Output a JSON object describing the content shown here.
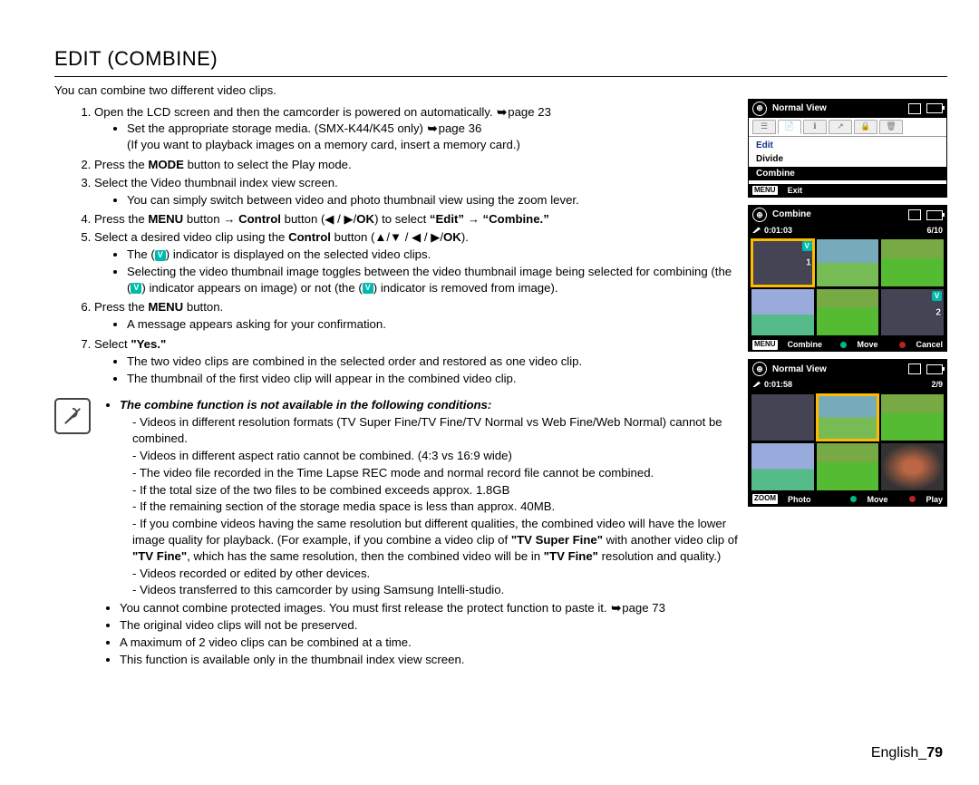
{
  "title": "EDIT (COMBINE)",
  "intro": "You can combine two different video clips.",
  "steps": {
    "s1": "Open the LCD screen and then the camcorder is powered on automatically.",
    "s1_page": "page 23",
    "s1_b1a": "Set the appropriate storage media. (SMX-K44/K45 only)",
    "s1_b1a_page": "page 36",
    "s1_b1b": "(If you want to playback images on a memory card, insert a memory card.)",
    "s2a": "Press the ",
    "s2_mode": "MODE",
    "s2b": " button to select the Play mode.",
    "s3": "Select the Video thumbnail index view screen.",
    "s3_b1": "You can simply switch between video and photo thumbnail view using the zoom lever.",
    "s4a": "Press the ",
    "s4_menu": "MENU",
    "s4b": " button → ",
    "s4_control": "Control",
    "s4c": " button (◀ / ▶/",
    "s4_ok": "OK",
    "s4d": ") to select ",
    "s4_edit": "“Edit”",
    "s4_arrow": " → ",
    "s4_combine": "“Combine.”",
    "s5a": "Select a desired video clip using the ",
    "s5_control": "Control",
    "s5b": " button (▲/▼ / ◀ / ▶/",
    "s5_ok": "OK",
    "s5c": ").",
    "s5_b1a": "The (",
    "s5_b1b": ") indicator is displayed on the selected video clips.",
    "s5_b2a": "Selecting the video thumbnail image toggles between the video thumbnail image being selected for combining (the (",
    "s5_b2b": ") indicator appears on image) or not (the (",
    "s5_b2c": ") indicator is removed from image).",
    "s6a": "Press the ",
    "s6_menu": "MENU",
    "s6b": " button.",
    "s6_b1": "A message appears asking for your confirmation.",
    "s7a": "Select ",
    "s7_yes": "\"Yes.\"",
    "s7_b1": "The two video clips are combined in the selected order and restored as one video clip.",
    "s7_b2": "The thumbnail of the first video clip will appear in the combined video clip."
  },
  "note": {
    "heading": "The combine function is not available in the following conditions:",
    "d1": "Videos in different resolution formats (TV Super Fine/TV Fine/TV Normal vs Web Fine/Web Normal) cannot be combined.",
    "d2": "Videos in different aspect ratio cannot be combined. (4:3 vs 16:9 wide)",
    "d3": "The video file recorded in the Time Lapse REC mode and normal record file cannot be combined.",
    "d4": "If the total size of the two files to be combined exceeds approx. 1.8GB",
    "d5": "If the remaining section of the storage media space is less than approx. 40MB.",
    "d6a": "If you combine videos having the same resolution but different qualities, the combined video will have the lower image quality for playback. (For example, if you combine a video clip of ",
    "d6_tsf": "\"TV Super Fine\"",
    "d6b": " with another video clip of ",
    "d6_tf": "\"TV Fine\"",
    "d6c": ", which has the same resolution, then the combined video will be in ",
    "d6_tf2": "\"TV Fine\"",
    "d6d": " resolution and quality.)",
    "d7": "Videos recorded or edited by other devices.",
    "d8": "Videos transferred to this camcorder by using Samsung Intelli-studio.",
    "b2a": "You cannot combine protected images. You must first release the protect function to paste it.",
    "b2_page": "page 73",
    "b3": "The original video clips will not be preserved.",
    "b4": "A maximum of 2 video clips can be combined at a time.",
    "b5": "This function is available only in the thumbnail index view screen."
  },
  "lcd1": {
    "header": "Normal View",
    "item_edit": "Edit",
    "item_divide": "Divide",
    "item_combine": "Combine",
    "ftr_menu": "MENU",
    "ftr_exit": "Exit"
  },
  "lcd2": {
    "header": "Combine",
    "time": "0:01:03",
    "count": "6/10",
    "ftr_menu": "MENU",
    "ftr_combine": "Combine",
    "ftr_move": "Move",
    "ftr_cancel": "Cancel"
  },
  "lcd3": {
    "header": "Normal View",
    "time": "0:01:58",
    "count": "2/9",
    "ftr_zoom": "ZOOM",
    "ftr_photo": "Photo",
    "ftr_move": "Move",
    "ftr_play": "Play"
  },
  "footer_lang": "English",
  "footer_page": "79"
}
